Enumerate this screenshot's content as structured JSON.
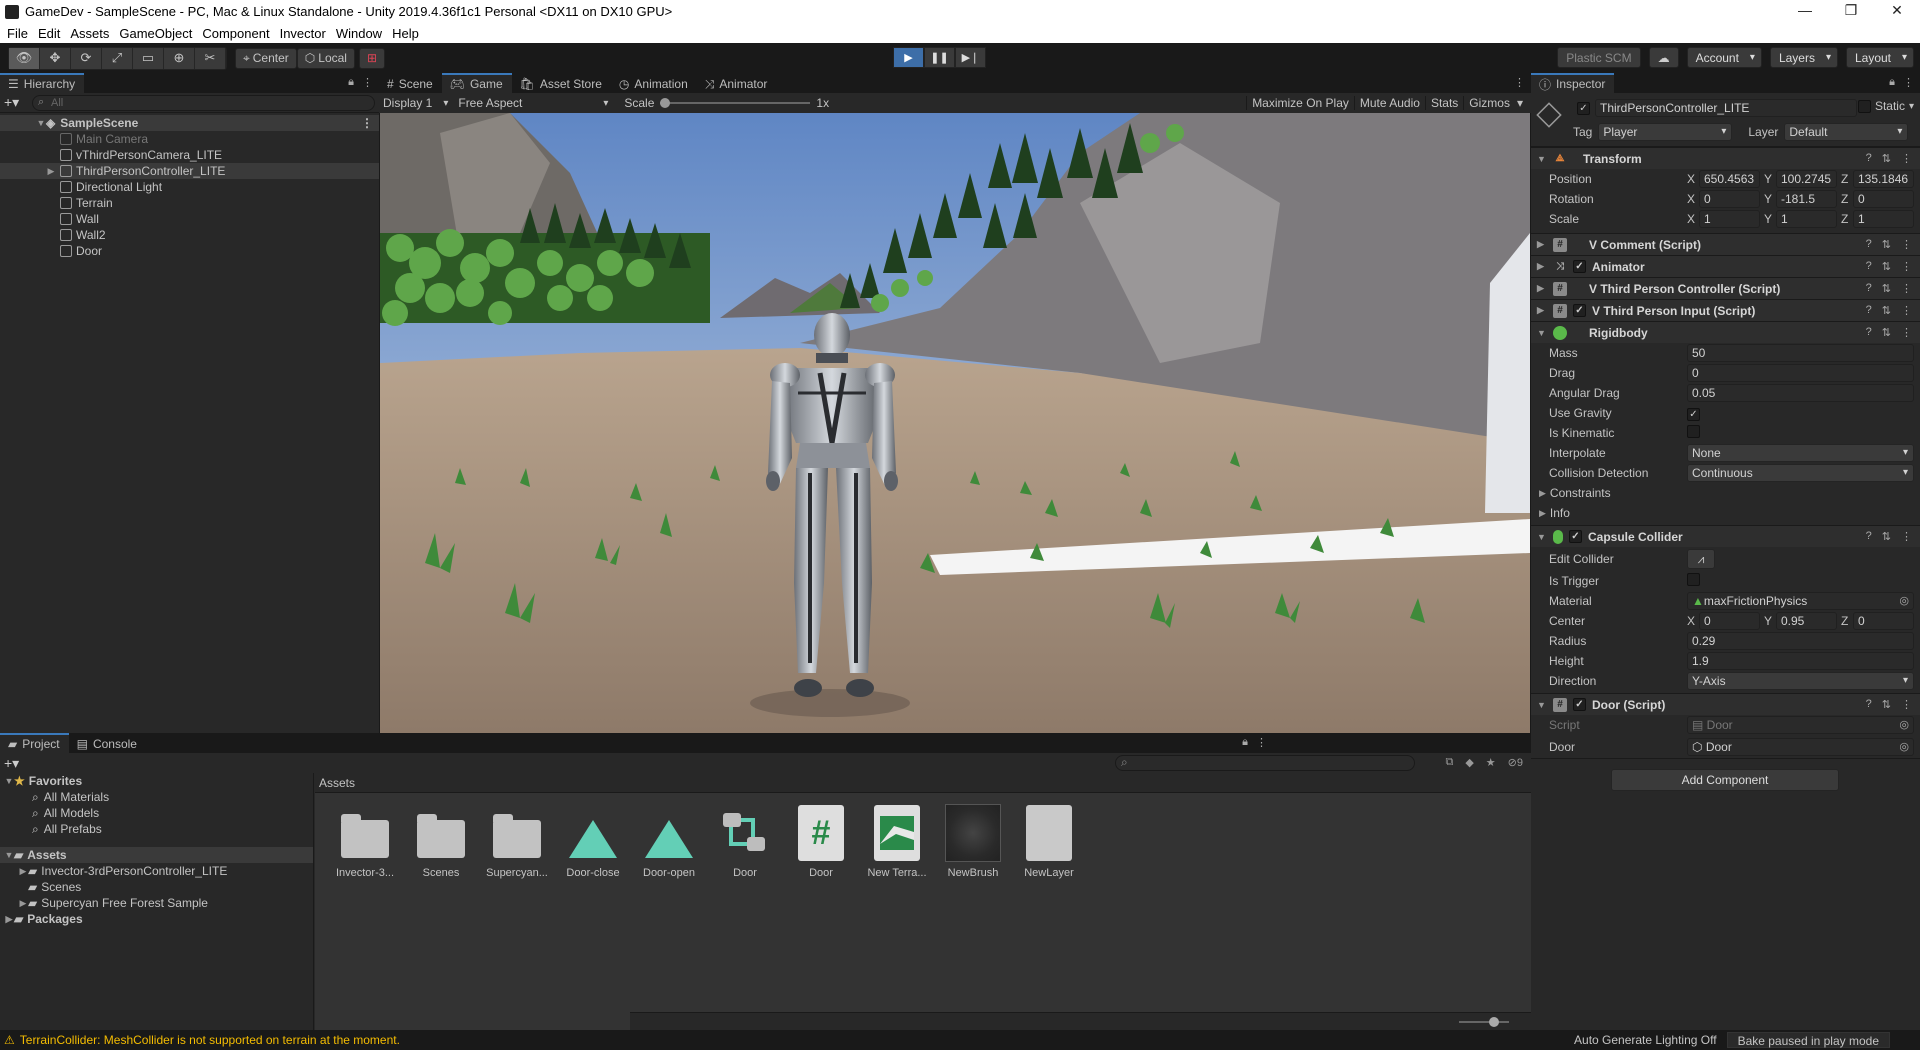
{
  "window": {
    "title": "GameDev - SampleScene - PC, Mac & Linux Standalone - Unity 2019.4.36f1c1 Personal <DX11 on DX10 GPU>",
    "controls": [
      "—",
      "❐",
      "✕"
    ]
  },
  "menu": [
    "File",
    "Edit",
    "Assets",
    "GameObject",
    "Component",
    "Invector",
    "Window",
    "Help"
  ],
  "toolbar": {
    "pivot": "Center",
    "space": "Local",
    "plastic": "Plastic SCM",
    "account": "Account",
    "layers": "Layers",
    "layout": "Layout"
  },
  "hierarchy": {
    "tab": "Hierarchy",
    "search_placeholder": "All",
    "scene": "SampleScene",
    "items": [
      {
        "label": "Main Camera",
        "dim": true
      },
      {
        "label": "vThirdPersonCamera_LITE",
        "dim": false
      },
      {
        "label": "ThirdPersonController_LITE",
        "dim": false,
        "selected": true,
        "expandable": true
      },
      {
        "label": "Directional Light",
        "dim": false
      },
      {
        "label": "Terrain",
        "dim": false
      },
      {
        "label": "Wall",
        "dim": false
      },
      {
        "label": "Wall2",
        "dim": false
      },
      {
        "label": "Door",
        "dim": false
      }
    ]
  },
  "center_tabs": [
    "Scene",
    "Game",
    "Asset Store",
    "Animation",
    "Animator"
  ],
  "game": {
    "display": "Display 1",
    "aspect": "Free Aspect",
    "scale_label": "Scale",
    "scale_value": "1x",
    "toggles": [
      "Maximize On Play",
      "Mute Audio",
      "Stats",
      "Gizmos"
    ]
  },
  "inspector": {
    "tab": "Inspector",
    "object_name": "ThirdPersonController_LITE",
    "static_label": "Static",
    "tag_label": "Tag",
    "tag_value": "Player",
    "layer_label": "Layer",
    "layer_value": "Default",
    "transform": {
      "title": "Transform",
      "position_label": "Position",
      "position": [
        "650.4563",
        "100.2745",
        "135.1846"
      ],
      "rotation_label": "Rotation",
      "rotation": [
        "0",
        "-181.5",
        "0"
      ],
      "scale_label": "Scale",
      "scale": [
        "1",
        "1",
        "1"
      ]
    },
    "components": [
      "V Comment (Script)",
      "Animator",
      "V Third Person Controller (Script)",
      "V Third Person Input (Script)"
    ],
    "rigidbody": {
      "title": "Rigidbody",
      "mass_label": "Mass",
      "mass": "50",
      "drag_label": "Drag",
      "drag": "0",
      "angular_drag_label": "Angular Drag",
      "angular_drag": "0.05",
      "use_gravity_label": "Use Gravity",
      "is_kinematic_label": "Is Kinematic",
      "interpolate_label": "Interpolate",
      "interpolate": "None",
      "collision_label": "Collision Detection",
      "collision": "Continuous",
      "constraints_label": "Constraints",
      "info_label": "Info"
    },
    "capsule": {
      "title": "Capsule Collider",
      "edit_label": "Edit Collider",
      "trigger_label": "Is Trigger",
      "material_label": "Material",
      "material": "maxFrictionPhysics",
      "center_label": "Center",
      "center": [
        "0",
        "0.95",
        "0"
      ],
      "radius_label": "Radius",
      "radius": "0.29",
      "height_label": "Height",
      "height": "1.9",
      "direction_label": "Direction",
      "direction": "Y-Axis"
    },
    "door": {
      "title": "Door (Script)",
      "script_label": "Script",
      "script": "Door",
      "door_label": "Door",
      "door": "Door"
    },
    "add_component": "Add Component"
  },
  "project": {
    "tabs": [
      "Project",
      "Console"
    ],
    "hidden_count": "9",
    "favorites_label": "Favorites",
    "favorites": [
      "All Materials",
      "All Models",
      "All Prefabs"
    ],
    "assets_label": "Assets",
    "asset_folders": [
      "Invector-3rdPersonController_LITE",
      "Scenes",
      "Supercyan Free Forest Sample"
    ],
    "packages_label": "Packages",
    "breadcrumb": "Assets",
    "assets": [
      {
        "name": "Invector-3...",
        "kind": "folder"
      },
      {
        "name": "Scenes",
        "kind": "folder"
      },
      {
        "name": "Supercyan...",
        "kind": "folder"
      },
      {
        "name": "Door-close",
        "kind": "anim"
      },
      {
        "name": "Door-open",
        "kind": "anim"
      },
      {
        "name": "Door",
        "kind": "controller"
      },
      {
        "name": "Door",
        "kind": "script"
      },
      {
        "name": "New Terra...",
        "kind": "terrain"
      },
      {
        "name": "NewBrush",
        "kind": "brush"
      },
      {
        "name": "NewLayer",
        "kind": "doc"
      }
    ]
  },
  "status": {
    "warning": "TerrainCollider: MeshCollider is not supported on terrain at the moment.",
    "lighting": "Auto Generate Lighting Off",
    "bake": "Bake paused in play mode"
  },
  "colors": {
    "accent": "#3a79bb",
    "play_active": "#3d6ea8",
    "warning": "#f4bc02",
    "anim_icon": "#63cfb6",
    "script_icon": "#2a8a4a"
  }
}
